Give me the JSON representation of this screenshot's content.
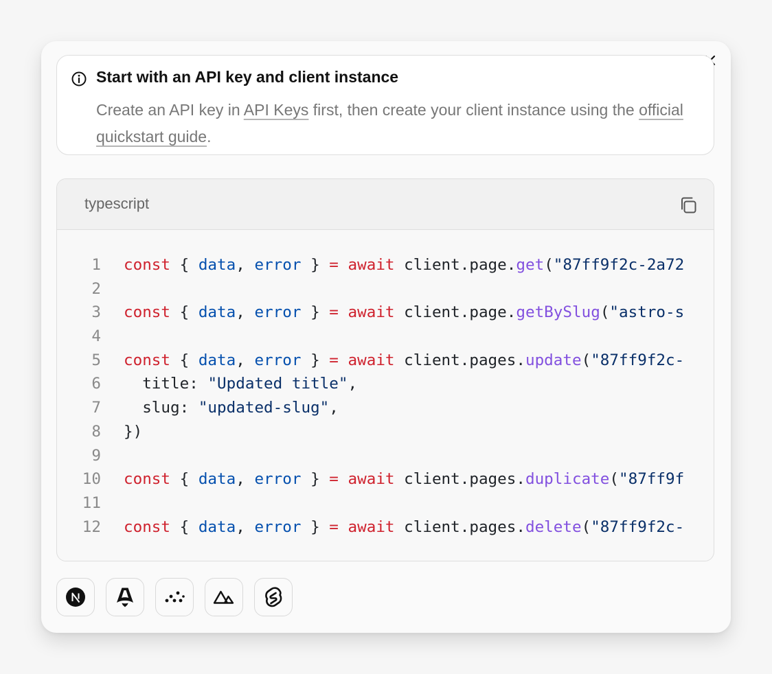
{
  "callout": {
    "title": "Start with an API key and client instance",
    "desc_part1": "Create an API key in ",
    "link_api_keys": "API Keys",
    "desc_part2": " first, then create your client instance using the ",
    "link_quickstart": "official quickstart guide",
    "desc_part3": "."
  },
  "code": {
    "language": "typescript",
    "lines": [
      {
        "num": "1",
        "tokens": [
          {
            "t": "const",
            "c": "kw"
          },
          {
            "t": " { ",
            "c": "punc"
          },
          {
            "t": "data",
            "c": "var"
          },
          {
            "t": ", ",
            "c": "punc"
          },
          {
            "t": "error",
            "c": "var"
          },
          {
            "t": " } ",
            "c": "punc"
          },
          {
            "t": "=",
            "c": "kw"
          },
          {
            "t": " ",
            "c": "punc"
          },
          {
            "t": "await",
            "c": "kw"
          },
          {
            "t": " client.page.",
            "c": "punc"
          },
          {
            "t": "get",
            "c": "fn"
          },
          {
            "t": "(",
            "c": "punc"
          },
          {
            "t": "\"87ff9f2c-2a72",
            "c": "str"
          }
        ]
      },
      {
        "num": "2",
        "tokens": []
      },
      {
        "num": "3",
        "tokens": [
          {
            "t": "const",
            "c": "kw"
          },
          {
            "t": " { ",
            "c": "punc"
          },
          {
            "t": "data",
            "c": "var"
          },
          {
            "t": ", ",
            "c": "punc"
          },
          {
            "t": "error",
            "c": "var"
          },
          {
            "t": " } ",
            "c": "punc"
          },
          {
            "t": "=",
            "c": "kw"
          },
          {
            "t": " ",
            "c": "punc"
          },
          {
            "t": "await",
            "c": "kw"
          },
          {
            "t": " client.page.",
            "c": "punc"
          },
          {
            "t": "getBySlug",
            "c": "fn"
          },
          {
            "t": "(",
            "c": "punc"
          },
          {
            "t": "\"astro-s",
            "c": "str"
          }
        ]
      },
      {
        "num": "4",
        "tokens": []
      },
      {
        "num": "5",
        "tokens": [
          {
            "t": "const",
            "c": "kw"
          },
          {
            "t": " { ",
            "c": "punc"
          },
          {
            "t": "data",
            "c": "var"
          },
          {
            "t": ", ",
            "c": "punc"
          },
          {
            "t": "error",
            "c": "var"
          },
          {
            "t": " } ",
            "c": "punc"
          },
          {
            "t": "=",
            "c": "kw"
          },
          {
            "t": " ",
            "c": "punc"
          },
          {
            "t": "await",
            "c": "kw"
          },
          {
            "t": " client.pages.",
            "c": "punc"
          },
          {
            "t": "update",
            "c": "fn"
          },
          {
            "t": "(",
            "c": "punc"
          },
          {
            "t": "\"87ff9f2c-",
            "c": "str"
          }
        ]
      },
      {
        "num": "6",
        "tokens": [
          {
            "t": "  title: ",
            "c": "punc"
          },
          {
            "t": "\"Updated title\"",
            "c": "str"
          },
          {
            "t": ",",
            "c": "punc"
          }
        ]
      },
      {
        "num": "7",
        "tokens": [
          {
            "t": "  slug: ",
            "c": "punc"
          },
          {
            "t": "\"updated-slug\"",
            "c": "str"
          },
          {
            "t": ",",
            "c": "punc"
          }
        ]
      },
      {
        "num": "8",
        "tokens": [
          {
            "t": "})",
            "c": "punc"
          }
        ]
      },
      {
        "num": "9",
        "tokens": []
      },
      {
        "num": "10",
        "tokens": [
          {
            "t": "const",
            "c": "kw"
          },
          {
            "t": " { ",
            "c": "punc"
          },
          {
            "t": "data",
            "c": "var"
          },
          {
            "t": ", ",
            "c": "punc"
          },
          {
            "t": "error",
            "c": "var"
          },
          {
            "t": " } ",
            "c": "punc"
          },
          {
            "t": "=",
            "c": "kw"
          },
          {
            "t": " ",
            "c": "punc"
          },
          {
            "t": "await",
            "c": "kw"
          },
          {
            "t": " client.pages.",
            "c": "punc"
          },
          {
            "t": "duplicate",
            "c": "fn"
          },
          {
            "t": "(",
            "c": "punc"
          },
          {
            "t": "\"87ff9f",
            "c": "str"
          }
        ]
      },
      {
        "num": "11",
        "tokens": []
      },
      {
        "num": "12",
        "tokens": [
          {
            "t": "const",
            "c": "kw"
          },
          {
            "t": " { ",
            "c": "punc"
          },
          {
            "t": "data",
            "c": "var"
          },
          {
            "t": ", ",
            "c": "punc"
          },
          {
            "t": "error",
            "c": "var"
          },
          {
            "t": " } ",
            "c": "punc"
          },
          {
            "t": "=",
            "c": "kw"
          },
          {
            "t": " ",
            "c": "punc"
          },
          {
            "t": "await",
            "c": "kw"
          },
          {
            "t": " client.pages.",
            "c": "punc"
          },
          {
            "t": "delete",
            "c": "fn"
          },
          {
            "t": "(",
            "c": "punc"
          },
          {
            "t": "\"87ff9f2c-",
            "c": "str"
          }
        ]
      }
    ]
  },
  "frameworks": [
    {
      "name": "nextjs",
      "icon": "nextjs-icon"
    },
    {
      "name": "astro",
      "icon": "astro-icon"
    },
    {
      "name": "analog",
      "icon": "analog-icon"
    },
    {
      "name": "nuxt",
      "icon": "nuxt-icon"
    },
    {
      "name": "svelte",
      "icon": "svelte-icon"
    }
  ],
  "colors": {
    "keyword": "#cf222e",
    "variable": "#0550ae",
    "function": "#8250df",
    "string": "#0a3069",
    "text": "#1f2328",
    "line_number": "#8a8a8a"
  }
}
